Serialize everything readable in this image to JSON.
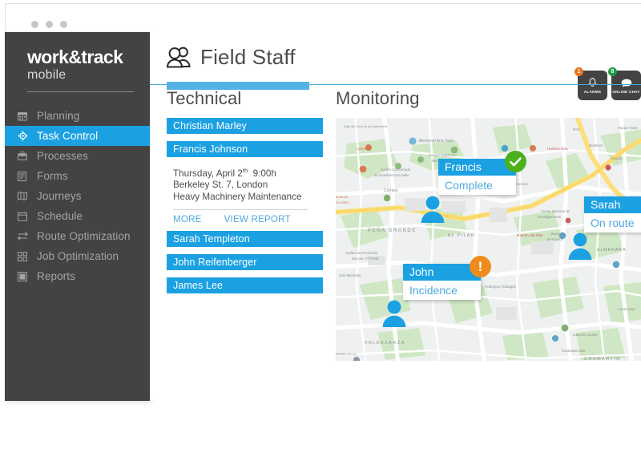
{
  "window": {
    "dots": [
      "dot-1",
      "dot-2",
      "dot-3"
    ]
  },
  "sidebar": {
    "brand_main": "work&track",
    "brand_sub": "mobile",
    "items": [
      {
        "label": "Planning",
        "icon": "calendar-icon",
        "active": false
      },
      {
        "label": "Task Control",
        "icon": "target-icon",
        "active": true
      },
      {
        "label": "Processes",
        "icon": "toolbox-icon",
        "active": false
      },
      {
        "label": "Forms",
        "icon": "form-icon",
        "active": false
      },
      {
        "label": "Journeys",
        "icon": "map-book-icon",
        "active": false
      },
      {
        "label": "Schedule",
        "icon": "schedule-icon",
        "active": false
      },
      {
        "label": "Route Optimization",
        "icon": "route-icon",
        "active": false
      },
      {
        "label": "Job Optimization",
        "icon": "grid-icon",
        "active": false
      },
      {
        "label": "Reports",
        "icon": "report-icon",
        "active": false
      }
    ]
  },
  "header": {
    "title": "Field Staff",
    "icon": "people-icon",
    "actions": [
      {
        "label": "ALARMS",
        "icon": "bell-icon",
        "badge": "1",
        "badge_color": "#e8711a"
      },
      {
        "label": "ONLINE\nCHAT",
        "icon": "chat-icon",
        "badge": "8",
        "badge_color": "#1c9c42"
      }
    ]
  },
  "technical": {
    "title": "Technical",
    "staff": [
      {
        "name": "Christian Marley",
        "expanded": false
      },
      {
        "name": "Francis Johnson",
        "expanded": true
      },
      {
        "name": "Sarah Templeton",
        "expanded": false
      },
      {
        "name": "John Reifenberger",
        "expanded": false
      },
      {
        "name": "James Lee",
        "expanded": false
      }
    ],
    "detail": {
      "date_prefix": "Thursday, April 2",
      "date_sup": "th",
      "date_time": "9:00h",
      "address": "Berkeley St. 7, London",
      "job": "Heavy Machinery Maintenance",
      "more_label": "MORE",
      "report_label": "VIEW REPORT"
    }
  },
  "monitoring": {
    "title": "Monitoring",
    "markers": [
      {
        "name": "Francis",
        "status": "Complete",
        "badge": "check",
        "badge_color": "#4caf1e"
      },
      {
        "name": "Sarah",
        "status": "On route",
        "badge": "check",
        "badge_color": "#e3e10f"
      },
      {
        "name": "John",
        "status": "Incidence",
        "badge": "exclamation",
        "badge_color": "#ef8b1d"
      }
    ],
    "map_labels": [
      "Calle del Cerro de los Carboneros",
      "Memorial Ana Tutor",
      "Lacoma",
      "Centro Deportivo Municipal La Masó",
      "Centro Concertado de Enseñanza la Salle",
      "Correos",
      "Herrera Oria",
      "Librería Akira Comics",
      "PEÑA GRANDE",
      "Audiencia Provincial Seccion 2ª Penal",
      "Antonio Machado",
      "EL PILAR",
      "Ramón del Pilar",
      "PAZ",
      "MANIVA",
      "Parque Norte",
      "Centro Nacional de Investigaciones",
      "Museo Geominero",
      "ALMENARA",
      "Rodríguez Sahagún",
      "VALDEZARZA",
      "Librería Alcaná",
      "Castellana 200",
      "CHAMARTÍN",
      "Cuatro Deportivo",
      "Begoña"
    ]
  },
  "colors": {
    "accent_blue": "#1ba1e2",
    "accent_blue_light": "#54b3e4",
    "link_blue": "#4fa9dd",
    "sidebar_dark": "#434343",
    "text_gray": "#4c4c4c",
    "muted_gray": "#a4a4a4"
  }
}
